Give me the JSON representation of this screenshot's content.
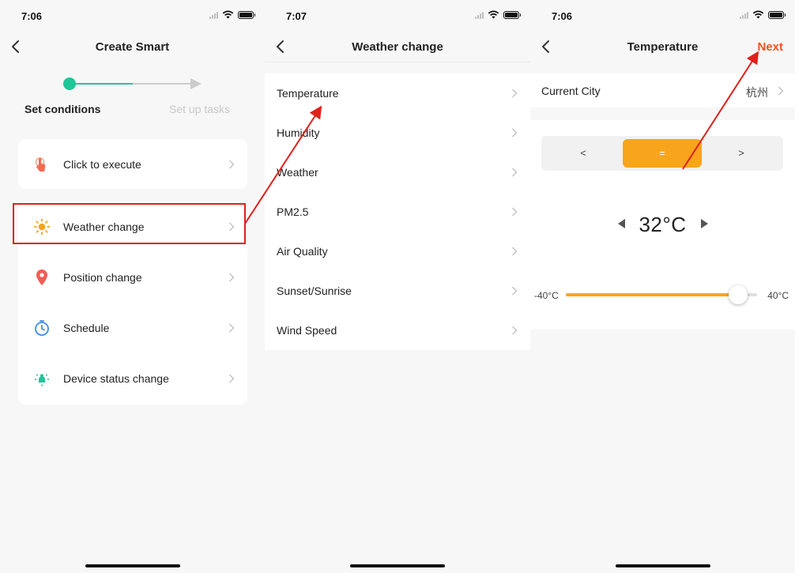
{
  "colors": {
    "accent_green": "#1fc698",
    "accent_orange": "#f9a51b",
    "next_red": "#f4511e",
    "annotation_red": "#e0201b"
  },
  "screen1": {
    "status_time": "7:06",
    "title": "Create Smart",
    "steps": {
      "current": "Set conditions",
      "next": "Set up tasks"
    },
    "items": [
      {
        "label": "Click to execute",
        "icon": "tap-hand-icon"
      },
      {
        "label": "Weather change",
        "icon": "sun-icon"
      },
      {
        "label": "Position change",
        "icon": "location-pin-icon"
      },
      {
        "label": "Schedule",
        "icon": "clock-icon"
      },
      {
        "label": "Device status change",
        "icon": "device-bulb-icon"
      }
    ]
  },
  "screen2": {
    "status_time": "7:07",
    "title": "Weather change",
    "items": [
      {
        "label": "Temperature"
      },
      {
        "label": "Humidity"
      },
      {
        "label": "Weather"
      },
      {
        "label": "PM2.5"
      },
      {
        "label": "Air Quality"
      },
      {
        "label": "Sunset/Sunrise"
      },
      {
        "label": "Wind Speed"
      }
    ]
  },
  "screen3": {
    "status_time": "7:06",
    "title": "Temperature",
    "next_label": "Next",
    "city_label": "Current City",
    "city_value": "杭州",
    "operators": [
      "<",
      "=",
      ">"
    ],
    "selected_operator": "=",
    "temperature": "32°C",
    "range_min_label": "-40°C",
    "range_max_label": "40°C",
    "slider": {
      "min": -40,
      "max": 40,
      "value": 32
    }
  }
}
